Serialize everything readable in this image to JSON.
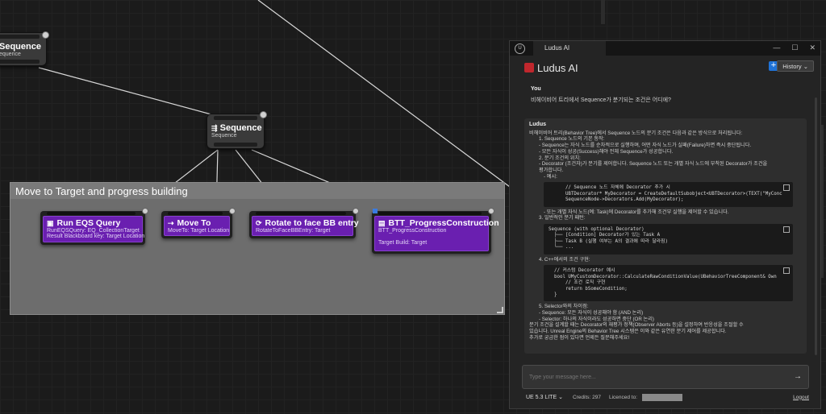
{
  "graph": {
    "root_node": {
      "title": "Sequence",
      "subtitle": "equence"
    },
    "sequence_node": {
      "title": "Sequence",
      "subtitle": "Sequence"
    },
    "comment": {
      "title": "Move to Target and progress building"
    },
    "tasks": [
      {
        "title": "Run EQS Query",
        "lines": [
          "RunEQSQuery: EQ_CollectionTarget",
          "Result Blackboard key: Target Location"
        ],
        "icon": "eqs-icon"
      },
      {
        "title": "Move To",
        "lines": [
          "MoveTo: Target Location"
        ],
        "icon": "move-to-icon"
      },
      {
        "title": "Rotate to face BB entry",
        "lines": [
          "RotateToFaceBBEntry: Target"
        ],
        "icon": "rotate-icon"
      },
      {
        "title": "BTT_ProgressConstruction",
        "lines": [
          "BTT_ProgressConstruction",
          "",
          "Target Build: Target"
        ],
        "icon": "task-icon"
      }
    ]
  },
  "panel": {
    "window_tab": "Ludus AI",
    "logo_text": "Ludus AI",
    "plus_label": "+",
    "history_label": "History ⌄",
    "user_label": "You",
    "user_message": "비헤이비어 트리에서 Sequence가 분기되는 조건은 어디에?",
    "reply_label": "Ludus",
    "reply_lines": [
      {
        "t": "비헤이비어 트리(Behavior Tree)에서 Sequence 노드의 분기 조건은 다음과 같은 방식으로 처리됩니다:",
        "c": ""
      },
      {
        "t": " ",
        "c": ""
      },
      {
        "t": "1. Sequence 노드의 기본 동작:",
        "c": "ind"
      },
      {
        "t": "- Sequence는 자식 노드를 순차적으로 실행하며, 어떤 자식 노드가 실패(Failure)하면 즉시 중단됩니다.",
        "c": "ind"
      },
      {
        "t": "- 모든 자식이 성공(Success)해야 전체 Sequence가 성공합니다.",
        "c": "ind"
      },
      {
        "t": "2. 분기 조건의 위치:",
        "c": "ind"
      },
      {
        "t": "- Decorator (조건자)가 분기를 제어합니다. Sequence 노드 또는 개별 자식 노드에 부착된 Decorator가 조건을",
        "c": "ind"
      },
      {
        "t": "평가합니다.",
        "c": "ind"
      },
      {
        "t": "- 예시:",
        "c": "ind2"
      }
    ],
    "code1": [
      "      // Sequence 노드 자체에 Decorator 추가 시",
      "      UBTDecorator* MyDecorator = CreateDefaultSubobject<UBTDecorator>(TEXT(\"MyConc",
      "      SequenceNode->Decorators.Add(MyDecorator);"
    ],
    "reply_lines2": [
      {
        "t": "- 또는 개별 자식 노드(예: Task)에 Decorator를 추가해 조건부 실행을 제어할 수 있습니다.",
        "c": "ind2"
      },
      {
        "t": "3. 일반적인 분기 패턴:",
        "c": "ind"
      }
    ],
    "code2": [
      "Sequence (with optional Decorator)",
      "  ├── [Condition] Decorator가 있는 Task A",
      "  ├── Task B (실행 여부는 A의 결과에 따라 달라짐)",
      "  └── ..."
    ],
    "reply_lines3": [
      {
        "t": "4. C++에서의 조건 구현:",
        "c": "ind"
      }
    ],
    "code3": [
      "  // 커스텀 Decorator 예시",
      "  bool UMyCustomDecorator::CalculateRawConditionValue(UBehaviorTreeComponent& Own",
      "      // 조건 로직 구현",
      "      return bSomeCondition;",
      "  }"
    ],
    "reply_lines4": [
      {
        "t": "5. Selector와의 차이점:",
        "c": "ind"
      },
      {
        "t": "- Sequence: 모든 자식이 성공해야 함 (AND 논리)",
        "c": "ind"
      },
      {
        "t": "- Selector: 하나의 자식이라도 성공하면 중단 (OR 논리)",
        "c": "ind"
      },
      {
        "t": "분기 조건을 설계할 때는 Decorator의 재평가 정책(Observer Aborts 등)을 설정하여 반응성을 조절할 수",
        "c": ""
      },
      {
        "t": "있습니다. Unreal Engine의 Behavior Tree 시스템은 이와 같은 유연한 분기 제어를 제공합니다.",
        "c": ""
      },
      {
        "t": "추가로 궁금한 점이 있다면 언제든 질문해주세요!",
        "c": ""
      }
    ],
    "input_placeholder": "Type your message here...",
    "send_icon": "→",
    "version": "UE 5.3 LITE ⌄",
    "credits": "Credits: 297",
    "licence": "Licenced to:",
    "logout": "Logout"
  }
}
